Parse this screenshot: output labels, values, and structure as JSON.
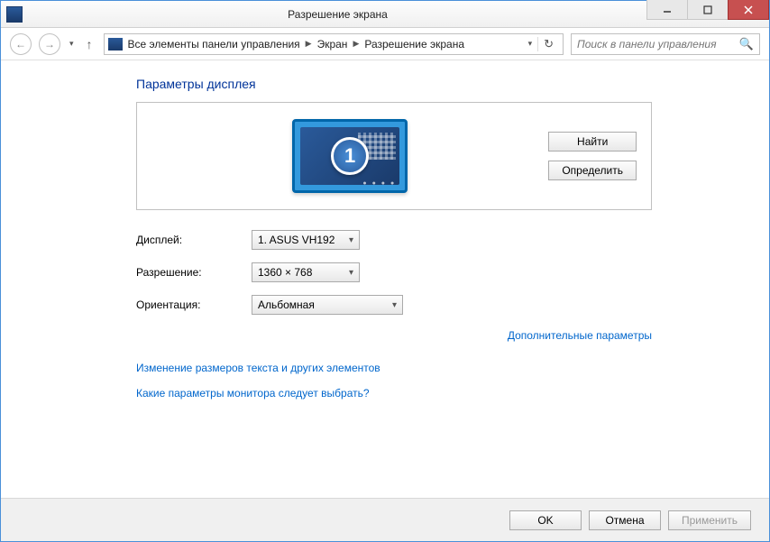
{
  "titlebar": {
    "title": "Разрешение экрана"
  },
  "nav": {
    "crumbs": [
      "Все элементы панели управления",
      "Экран",
      "Разрешение экрана"
    ],
    "search_placeholder": "Поиск в панели управления"
  },
  "content": {
    "heading": "Параметры дисплея",
    "monitor_number": "1",
    "find_btn": "Найти",
    "identify_btn": "Определить",
    "labels": {
      "display": "Дисплей:",
      "resolution": "Разрешение:",
      "orientation": "Ориентация:"
    },
    "values": {
      "display": "1. ASUS VH192",
      "resolution": "1360 × 768",
      "orientation": "Альбомная"
    },
    "adv_link": "Дополнительные параметры",
    "link_resize": "Изменение размеров текста и других элементов",
    "link_help": "Какие параметры монитора следует выбрать?"
  },
  "footer": {
    "ok": "OK",
    "cancel": "Отмена",
    "apply": "Применить"
  }
}
